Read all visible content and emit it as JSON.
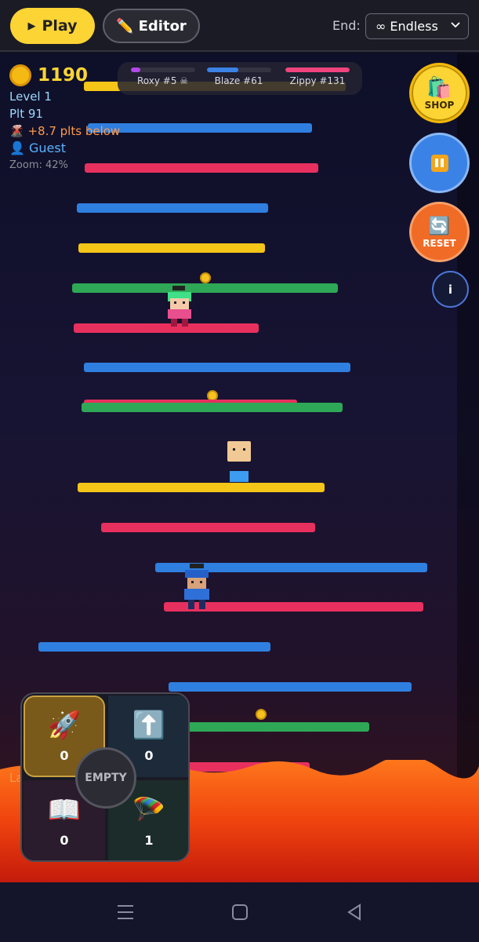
{
  "topbar": {
    "play_label": "Play",
    "editor_label": "Editor",
    "end_label": "End:",
    "end_value": "∞ Endless"
  },
  "hud": {
    "coins": "1190",
    "level": "Level 1",
    "platform": "Plt 91",
    "lava_speed": "Lava: 0.7 plt/s",
    "below": "+8.7 plts below",
    "player": "Guest",
    "zoom": "Zoom: 42%"
  },
  "race": {
    "racers": [
      {
        "label": "Roxy #5 ☠",
        "color": "#b348e8",
        "progress": 0.15
      },
      {
        "label": "Blaze #61",
        "color": "#3b82e6",
        "progress": 0.5
      },
      {
        "label": "Zippy #131",
        "color": "#f0447e",
        "progress": 1.0
      }
    ]
  },
  "side_buttons": {
    "shop_label": "SHOP",
    "reset_label": "RESET",
    "info_label": "i"
  },
  "powerups": {
    "rocket_count": "0",
    "jump_count": "0",
    "book_count": "0",
    "parachute_count": "1",
    "center_label": "EMPTY"
  },
  "colors": {
    "yellow": "#f5c518",
    "blue": "#2f7fe0",
    "pink": "#e8305e",
    "green": "#2ea856",
    "accent": "#fcd434"
  },
  "icons": [
    "play-icon",
    "pencil-icon",
    "chevron-down-icon",
    "coin-icon",
    "volcano-icon",
    "user-icon",
    "shopping-bag-icon",
    "pause-icon",
    "reset-icon",
    "info-icon",
    "rocket-icon",
    "up-arrow-icon",
    "book-icon",
    "parachute-icon",
    "menu-icon",
    "home-icon",
    "back-icon"
  ]
}
